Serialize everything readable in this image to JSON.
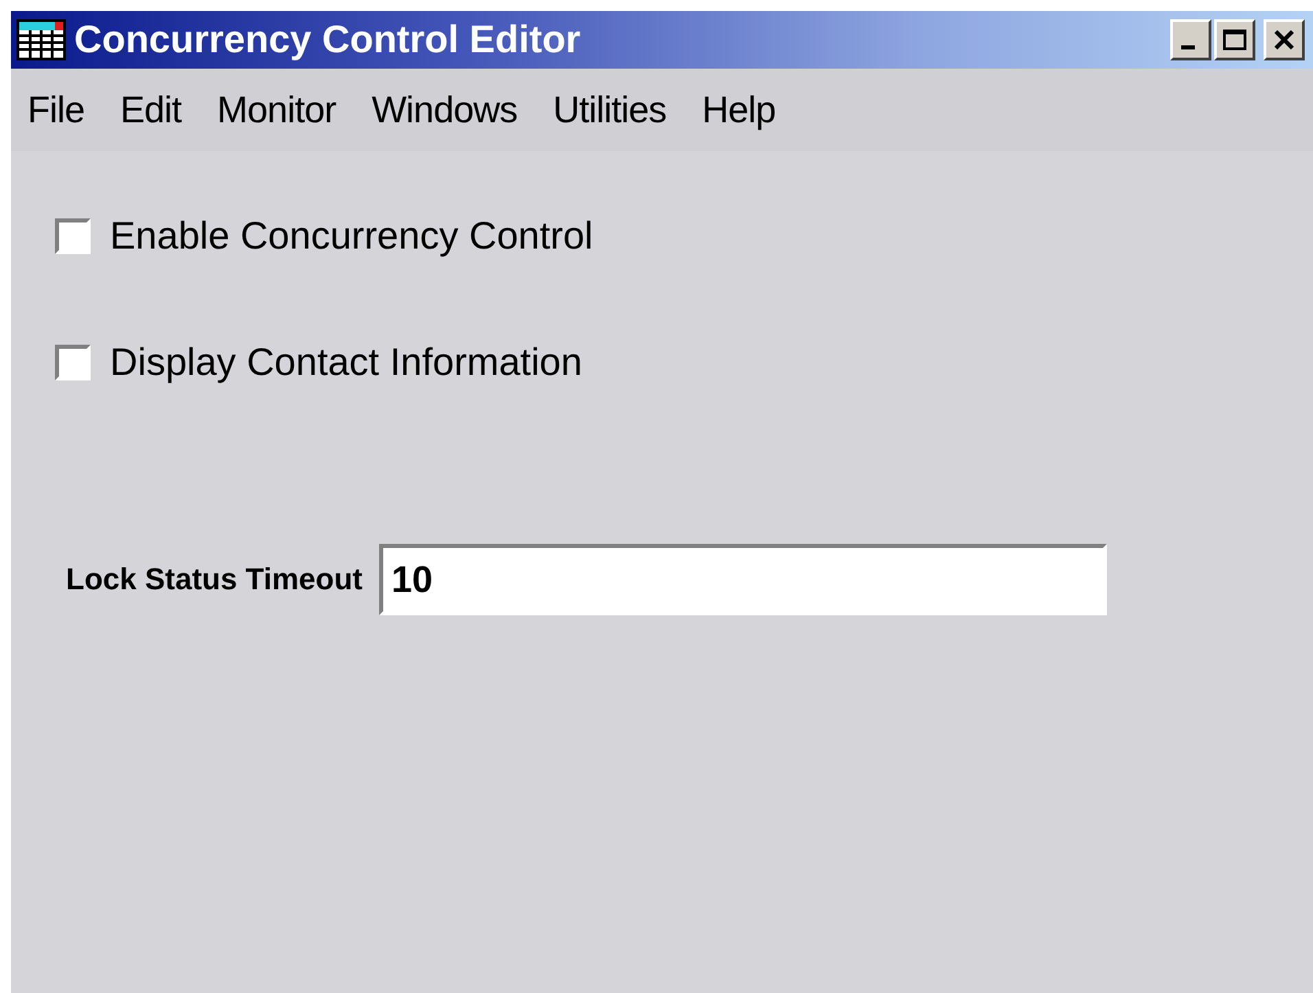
{
  "window": {
    "title": "Concurrency Control Editor"
  },
  "menu": [
    "File",
    "Edit",
    "Monitor",
    "Windows",
    "Utilities",
    "Help"
  ],
  "options": [
    {
      "label": "Enable Concurrency Control",
      "checked": false
    },
    {
      "label": "Display Contact Information",
      "checked": false
    }
  ],
  "timeout": {
    "label": "Lock Status Timeout",
    "value": "10"
  }
}
